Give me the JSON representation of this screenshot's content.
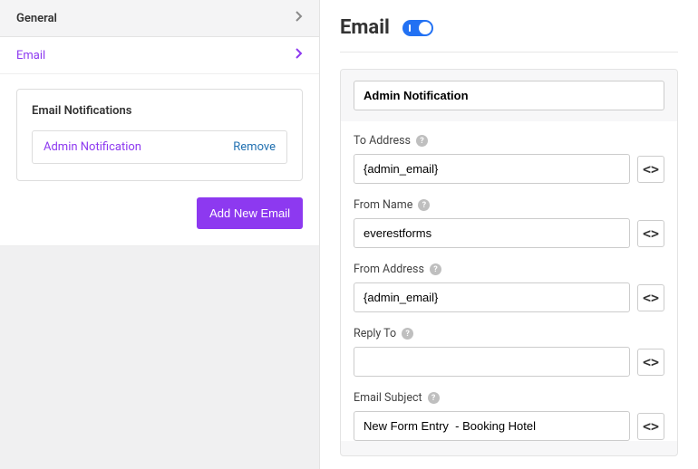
{
  "sidebar": {
    "general_label": "General",
    "email_label": "Email",
    "notifications": {
      "title": "Email Notifications",
      "item_name": "Admin Notification",
      "remove_label": "Remove"
    },
    "add_button": "Add New Email"
  },
  "main": {
    "title": "Email",
    "toggle_on": true,
    "notification_title": "Admin Notification",
    "fields": {
      "to_address": {
        "label": "To Address",
        "value": "{admin_email}"
      },
      "from_name": {
        "label": "From Name",
        "value": "everestforms"
      },
      "from_address": {
        "label": "From Address",
        "value": "{admin_email}"
      },
      "reply_to": {
        "label": "Reply To",
        "value": ""
      },
      "email_subject": {
        "label": "Email Subject",
        "value": "New Form Entry  - Booking Hotel"
      }
    },
    "code_label": "<>"
  }
}
